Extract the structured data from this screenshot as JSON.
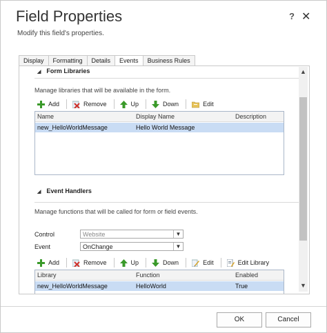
{
  "dialog": {
    "title": "Field Properties",
    "subtitle": "Modify this field's properties.",
    "help_label": "?",
    "close_label": "✕"
  },
  "tabs": [
    {
      "label": "Display"
    },
    {
      "label": "Formatting"
    },
    {
      "label": "Details"
    },
    {
      "label": "Events",
      "active": true
    },
    {
      "label": "Business Rules"
    }
  ],
  "form_libraries": {
    "title": "Form Libraries",
    "description": "Manage libraries that will be available in the form.",
    "toolbar": {
      "add": "Add",
      "remove": "Remove",
      "up": "Up",
      "down": "Down",
      "edit": "Edit"
    },
    "columns": [
      "Name",
      "Display Name",
      "Description"
    ],
    "rows": [
      {
        "name": "new_HelloWorldMessage",
        "display_name": "Hello World Message",
        "description": ""
      }
    ]
  },
  "event_handlers": {
    "title": "Event Handlers",
    "description": "Manage functions that will be called for form or field events.",
    "control_label": "Control",
    "control_value": "Website",
    "event_label": "Event",
    "event_value": "OnChange",
    "toolbar": {
      "add": "Add",
      "remove": "Remove",
      "up": "Up",
      "down": "Down",
      "edit": "Edit",
      "edit_library": "Edit Library"
    },
    "columns": [
      "Library",
      "Function",
      "Enabled"
    ],
    "rows": [
      {
        "library": "new_HelloWorldMessage",
        "function": "HelloWorld",
        "enabled": "True"
      }
    ]
  },
  "footer": {
    "ok": "OK",
    "cancel": "Cancel"
  },
  "icons": {
    "add": "green-plus-icon",
    "remove": "red-x-icon",
    "up": "green-up-arrow-icon",
    "down": "green-down-arrow-icon",
    "edit": "folder-edit-icon",
    "edit_handler": "pencil-edit-icon",
    "edit_library": "document-edit-icon"
  },
  "colors": {
    "selected_row": "#c9dcf4",
    "grid_border": "#a9b6c8",
    "scroll_thumb": "#c2c2c2"
  }
}
